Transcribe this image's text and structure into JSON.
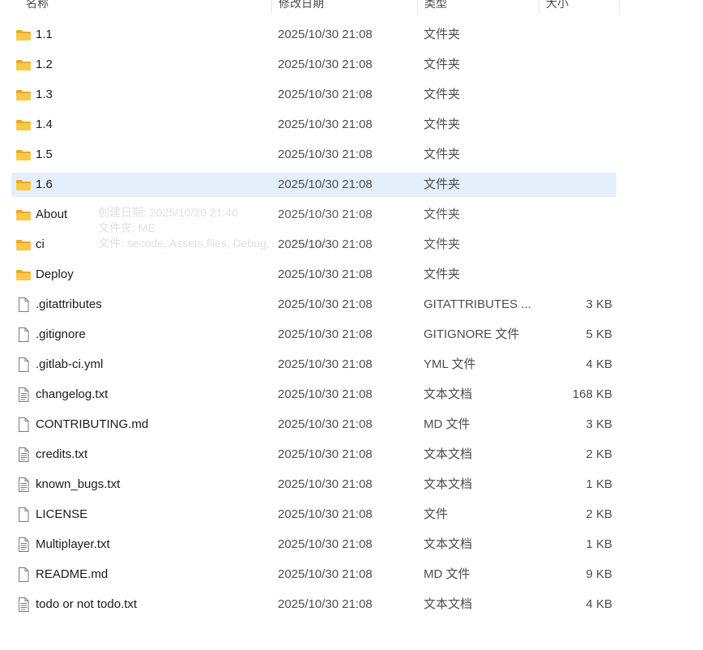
{
  "columns": {
    "name": "名称",
    "date": "修改日期",
    "type": "类型",
    "size": "大小"
  },
  "tooltip": {
    "line1": "创建日期: 2025/10/20 21:40",
    "line2": "文件夹: ME",
    "line3": "文件: secode, Assets.files, Debug, ... , Patches ..."
  },
  "colors": {
    "selected_bg": "#e3effb",
    "folder": "#f8c84a",
    "folder_dark": "#e9a825"
  },
  "files": [
    {
      "icon": "folder-icon",
      "name": "1.1",
      "date": "2025/10/30 21:08",
      "type": "文件夹",
      "size": ""
    },
    {
      "icon": "folder-icon",
      "name": "1.2",
      "date": "2025/10/30 21:08",
      "type": "文件夹",
      "size": ""
    },
    {
      "icon": "folder-icon",
      "name": "1.3",
      "date": "2025/10/30 21:08",
      "type": "文件夹",
      "size": ""
    },
    {
      "icon": "folder-icon",
      "name": "1.4",
      "date": "2025/10/30 21:08",
      "type": "文件夹",
      "size": ""
    },
    {
      "icon": "folder-icon",
      "name": "1.5",
      "date": "2025/10/30 21:08",
      "type": "文件夹",
      "size": ""
    },
    {
      "icon": "folder-icon",
      "name": "1.6",
      "date": "2025/10/30 21:08",
      "type": "文件夹",
      "size": "",
      "selected": true
    },
    {
      "icon": "folder-icon",
      "name": "About",
      "date": "2025/10/30 21:08",
      "type": "文件夹",
      "size": ""
    },
    {
      "icon": "folder-icon",
      "name": "ci",
      "date": "2025/10/30 21:08",
      "type": "文件夹",
      "size": ""
    },
    {
      "icon": "folder-icon",
      "name": "Deploy",
      "date": "2025/10/30 21:08",
      "type": "文件夹",
      "size": ""
    },
    {
      "icon": "file-icon",
      "name": ".gitattributes",
      "date": "2025/10/30 21:08",
      "type": "GITATTRIBUTES ...",
      "size": "3 KB"
    },
    {
      "icon": "file-icon",
      "name": ".gitignore",
      "date": "2025/10/30 21:08",
      "type": "GITIGNORE 文件",
      "size": "5 KB"
    },
    {
      "icon": "file-icon",
      "name": ".gitlab-ci.yml",
      "date": "2025/10/30 21:08",
      "type": "YML 文件",
      "size": "4 KB"
    },
    {
      "icon": "text-file-icon",
      "name": "changelog.txt",
      "date": "2025/10/30 21:08",
      "type": "文本文档",
      "size": "168 KB"
    },
    {
      "icon": "file-icon",
      "name": "CONTRIBUTING.md",
      "date": "2025/10/30 21:08",
      "type": "MD 文件",
      "size": "3 KB"
    },
    {
      "icon": "text-file-icon",
      "name": "credits.txt",
      "date": "2025/10/30 21:08",
      "type": "文本文档",
      "size": "2 KB"
    },
    {
      "icon": "text-file-icon",
      "name": "known_bugs.txt",
      "date": "2025/10/30 21:08",
      "type": "文本文档",
      "size": "1 KB"
    },
    {
      "icon": "file-icon",
      "name": "LICENSE",
      "date": "2025/10/30 21:08",
      "type": "文件",
      "size": "2 KB"
    },
    {
      "icon": "text-file-icon",
      "name": "Multiplayer.txt",
      "date": "2025/10/30 21:08",
      "type": "文本文档",
      "size": "1 KB"
    },
    {
      "icon": "file-icon",
      "name": "README.md",
      "date": "2025/10/30 21:08",
      "type": "MD 文件",
      "size": "9 KB"
    },
    {
      "icon": "text-file-icon",
      "name": "todo or not todo.txt",
      "date": "2025/10/30 21:08",
      "type": "文本文档",
      "size": "4 KB"
    }
  ]
}
